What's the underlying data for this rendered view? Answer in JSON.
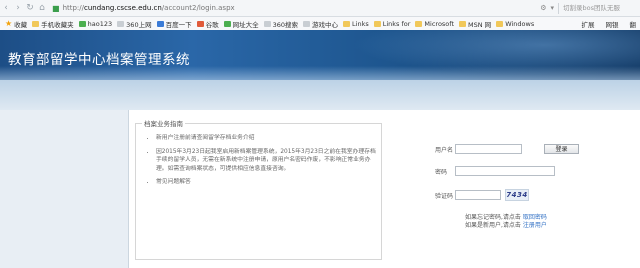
{
  "browser": {
    "url_prefix": "http://",
    "url_domain": "cundang.cscse.edu.cn",
    "url_path": "/account2/login.aspx",
    "search_text": "切割录bos团队无服",
    "bookmarks": [
      {
        "label": "收藏",
        "icon": "star-icon"
      },
      {
        "label": "手机收藏夹",
        "icon": "folder-icon"
      },
      {
        "label": "hao123",
        "icon": "hao123-icon"
      },
      {
        "label": "360上网",
        "icon": "page-icon"
      },
      {
        "label": "百度一下",
        "icon": "baidu-icon"
      },
      {
        "label": "谷歌",
        "icon": "google-icon"
      },
      {
        "label": "网址大全",
        "icon": "green-icon"
      },
      {
        "label": "360搜索",
        "icon": "page-icon"
      },
      {
        "label": "游戏中心",
        "icon": "page-icon"
      },
      {
        "label": "Links",
        "icon": "folder-icon"
      },
      {
        "label": "Links for",
        "icon": "folder-icon"
      },
      {
        "label": "Microsoft",
        "icon": "folder-icon"
      },
      {
        "label": "MSN 网",
        "icon": "folder-icon"
      },
      {
        "label": "Windows",
        "icon": "folder-icon"
      }
    ],
    "right_tools": [
      "扩展",
      "网银",
      "翻"
    ]
  },
  "header": {
    "title": "教育部留学中心档案管理系统"
  },
  "notice": {
    "legend": "档案业务指南",
    "items": [
      "新用户注册前请查阅留学存档业务介绍",
      "因2015年3月23日起我室启用新档案管理系统，2015年3月23日之前在我室办理存档手续的留学人员，无需在新系统中注册申请，原用户名密码作废，不影响正常业务办理。如需查询档案状态，可提供相应信息直接咨询。",
      "常见问题解答"
    ]
  },
  "login": {
    "username_label": "用户名",
    "password_label": "密码",
    "captcha_label": "验证码",
    "login_button": "登录",
    "captcha_text": "7434",
    "forgot_prefix": "如果忘记密码,请点击 ",
    "forgot_link": "取回密码",
    "register_prefix": "如果是新用户,请点击 ",
    "register_link": "注册用户"
  }
}
